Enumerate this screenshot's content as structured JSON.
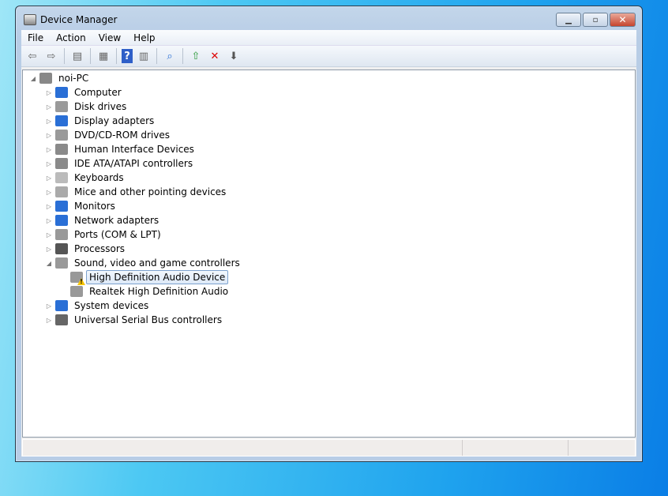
{
  "window": {
    "title": "Device Manager"
  },
  "menu": [
    "File",
    "Action",
    "View",
    "Help"
  ],
  "toolbar": [
    "back-icon",
    "forward-icon",
    "show-hide-console-tree-icon",
    "properties-icon",
    "help-icon",
    "show-action-pane-icon",
    "scan-hardware-icon",
    "update-driver-icon",
    "uninstall-icon",
    "disable-icon"
  ],
  "tree": {
    "root": "noi-PC",
    "categories": [
      {
        "label": "Computer",
        "color": "#2a6fd6"
      },
      {
        "label": "Disk drives",
        "color": "#9a9a9a"
      },
      {
        "label": "Display adapters",
        "color": "#2a6fd6"
      },
      {
        "label": "DVD/CD-ROM drives",
        "color": "#9a9a9a"
      },
      {
        "label": "Human Interface Devices",
        "color": "#8a8a8a"
      },
      {
        "label": "IDE ATA/ATAPI controllers",
        "color": "#8a8a8a"
      },
      {
        "label": "Keyboards",
        "color": "#bbbbbb"
      },
      {
        "label": "Mice and other pointing devices",
        "color": "#aaaaaa"
      },
      {
        "label": "Monitors",
        "color": "#2a6fd6"
      },
      {
        "label": "Network adapters",
        "color": "#2a6fd6"
      },
      {
        "label": "Ports (COM & LPT)",
        "color": "#999999"
      },
      {
        "label": "Processors",
        "color": "#555555"
      },
      {
        "label": "Sound, video and game controllers",
        "color": "#999999",
        "expanded": true,
        "children": [
          {
            "label": "High Definition Audio Device",
            "warning": true,
            "selected": true
          },
          {
            "label": "Realtek High Definition Audio"
          }
        ]
      },
      {
        "label": "System devices",
        "color": "#2a6fd6"
      },
      {
        "label": "Universal Serial Bus controllers",
        "color": "#666666"
      }
    ]
  }
}
